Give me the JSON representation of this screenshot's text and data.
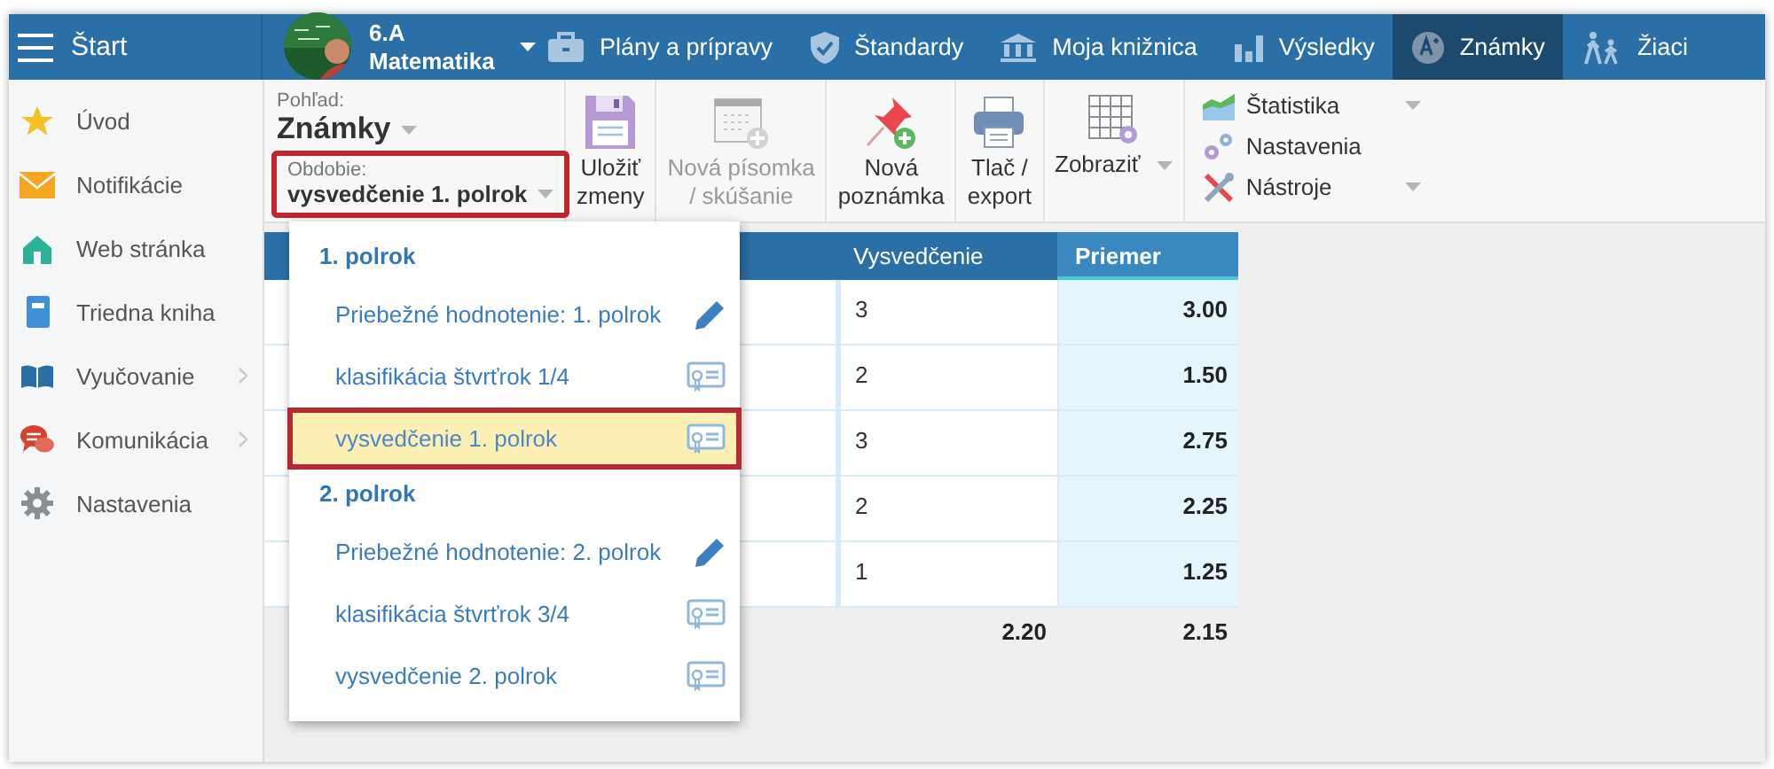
{
  "topbar": {
    "menu_label": "Štart",
    "class": {
      "name": "6.A",
      "subject": "Matematika"
    },
    "nav": [
      {
        "label": "Plány a prípravy",
        "selected": false
      },
      {
        "label": "Štandardy",
        "selected": false
      },
      {
        "label": "Moja knižnica",
        "selected": false
      },
      {
        "label": "Výsledky",
        "selected": false
      },
      {
        "label": "Známky",
        "selected": true
      },
      {
        "label": "Žiaci",
        "selected": false
      }
    ]
  },
  "sidebar": {
    "items": [
      {
        "label": "Úvod",
        "has_submenu": false
      },
      {
        "label": "Notifikácie",
        "has_submenu": false
      },
      {
        "label": "Web stránka",
        "has_submenu": false
      },
      {
        "label": "Triedna kniha",
        "has_submenu": false
      },
      {
        "label": "Vyučovanie",
        "has_submenu": true
      },
      {
        "label": "Komunikácia",
        "has_submenu": true
      },
      {
        "label": "Nastavenia",
        "has_submenu": false
      }
    ]
  },
  "toolbar": {
    "view": {
      "label": "Pohľad:",
      "value": "Známky"
    },
    "period": {
      "label": "Obdobie:",
      "value": "vysvedčenie 1. polrok",
      "highlighted": true
    },
    "buttons": [
      {
        "lines": [
          "Uložiť",
          "zmeny"
        ],
        "disabled": false,
        "has_dropdown": false
      },
      {
        "lines": [
          "Nová písomka",
          "/ skúšanie"
        ],
        "disabled": true,
        "has_dropdown": false
      },
      {
        "lines": [
          "Nová",
          "poznámka"
        ],
        "disabled": false,
        "has_dropdown": false
      },
      {
        "lines": [
          "Tlač /",
          "export"
        ],
        "disabled": false,
        "has_dropdown": false
      },
      {
        "lines": [
          "Zobraziť"
        ],
        "disabled": false,
        "has_dropdown": true
      }
    ],
    "side_menu": [
      {
        "label": "Štatistika",
        "has_dropdown": true
      },
      {
        "label": "Nastavenia",
        "has_dropdown": false
      },
      {
        "label": "Nástroje",
        "has_dropdown": true
      }
    ]
  },
  "table": {
    "columns": [
      "Vysvedčenie",
      "Priemer"
    ],
    "rows": [
      {
        "vysvedcenie": "3",
        "priemer": "3.00"
      },
      {
        "vysvedcenie": "2",
        "priemer": "1.50"
      },
      {
        "vysvedcenie": "3",
        "priemer": "2.75"
      },
      {
        "vysvedcenie": "2",
        "priemer": "2.25"
      },
      {
        "vysvedcenie": "1",
        "priemer": "1.25"
      }
    ],
    "totals": [
      "2.20",
      "2.15"
    ]
  },
  "dropdown": {
    "groups": [
      {
        "title": "1. polrok",
        "items": [
          {
            "label": "Priebežné hodnotenie: 1. polrok",
            "kind": "ongoing",
            "selected": false
          },
          {
            "label": "klasifikácia štvrťrok 1/4",
            "kind": "report",
            "selected": false
          },
          {
            "label": "vysvedčenie 1. polrok",
            "kind": "report",
            "selected": true
          }
        ]
      },
      {
        "title": "2. polrok",
        "items": [
          {
            "label": "Priebežné hodnotenie: 2. polrok",
            "kind": "ongoing",
            "selected": false
          },
          {
            "label": "klasifikácia štvrťrok 3/4",
            "kind": "report",
            "selected": false
          },
          {
            "label": "vysvedčenie 2. polrok",
            "kind": "report",
            "selected": false
          }
        ]
      }
    ]
  }
}
